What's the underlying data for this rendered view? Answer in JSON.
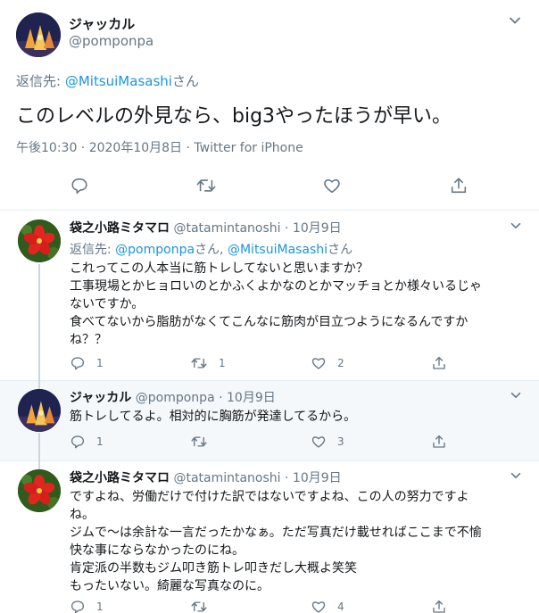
{
  "main_tweet": {
    "display_name": "ジャッカル",
    "handle": "@pomponpa",
    "reply_prefix": "返信先: ",
    "reply_handle": "@MitsuiMasashi",
    "reply_suffix": "さん",
    "text": "このレベルの外見なら、big3やったほうが早い。",
    "meta": "午後10:30 · 2020年10月8日 · Twitter for iPhone",
    "icons": [
      "reply-icon",
      "retweet-icon",
      "like-icon",
      "share-icon"
    ]
  },
  "replies": [
    {
      "display_name": "袋之小路ミタマロ",
      "handle": "@tatamintanoshi",
      "date": "10月9日",
      "reply_prefix": "返信先: ",
      "reply_handle_1": "@pomponpa",
      "reply_mid": "さん, ",
      "reply_handle_2": "@MitsuiMasashi",
      "reply_suffix": "さん",
      "lines": [
        "これってこの人本当に筋トレしてないと思いますか？",
        "工事現場とかヒョロいのとかふくよかなのとかマッチョとか様々いるじゃ",
        "ないですか。",
        "食べてないから脂肪がなくてこんなに筋肉が目立つようになるんですか",
        "ね？？"
      ],
      "reply_count": "1",
      "retweet_count": "1",
      "like_count": "2"
    },
    {
      "display_name": "ジャッカル",
      "handle": "@pomponpa",
      "date": "10月9日",
      "lines": [
        "筋トレしてるよ。相対的に胸筋が発達してるから。"
      ],
      "reply_count": "1",
      "retweet_count": "",
      "like_count": "3"
    },
    {
      "display_name": "袋之小路ミタマロ",
      "handle": "@tatamintanoshi",
      "date": "10月9日",
      "lines": [
        "ですよね、労働だけで付けた訳ではないですよね、この人の努力ですよ",
        "ね。",
        "ジムで〜は余計な一言だったかなぁ。ただ写真だけ載せればここまで不愉",
        "快な事にならなかったのにね。",
        "肯定派の半数もジム叩き筋トレ叩きだし大概よ笑笑",
        "もったいない。綺麗な写真なのに。"
      ],
      "reply_count": "1",
      "retweet_count": "",
      "like_count": "4"
    }
  ],
  "colors": {
    "text": "#14171a",
    "secondary": "#657786",
    "link": "#1b95e0",
    "divider": "#e6ecf0",
    "highlight_bg": "#f5f8fa"
  }
}
